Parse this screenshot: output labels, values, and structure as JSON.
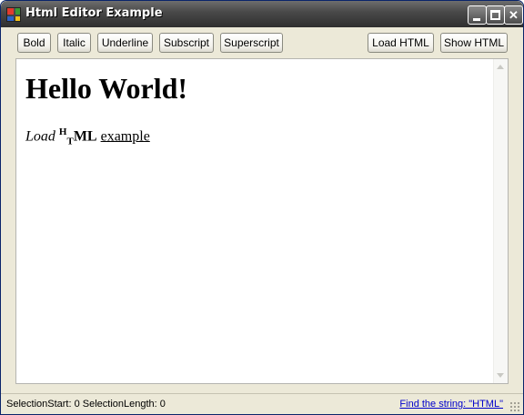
{
  "window": {
    "title": "Html Editor Example"
  },
  "titlebar_buttons": {
    "close_glyph": "✕"
  },
  "toolbar": {
    "bold": "Bold",
    "italic": "Italic",
    "underline": "Underline",
    "subscript": "Subscript",
    "superscript": "Superscript",
    "load_html": "Load HTML",
    "show_html": "Show HTML"
  },
  "editor": {
    "heading": "Hello World!",
    "line_italic": "Load",
    "line_sup": "H",
    "line_sub": "T",
    "line_bold": "ML",
    "line_underline": "example"
  },
  "status": {
    "selection": "SelectionStart: 0 SelectionLength: 0",
    "find_link": "Find the string: \"HTML\""
  },
  "icons": [
    "app-icon",
    "minimize-icon",
    "maximize-icon",
    "close-icon",
    "scroll-up-icon",
    "scroll-down-icon",
    "size-grip-icon"
  ]
}
